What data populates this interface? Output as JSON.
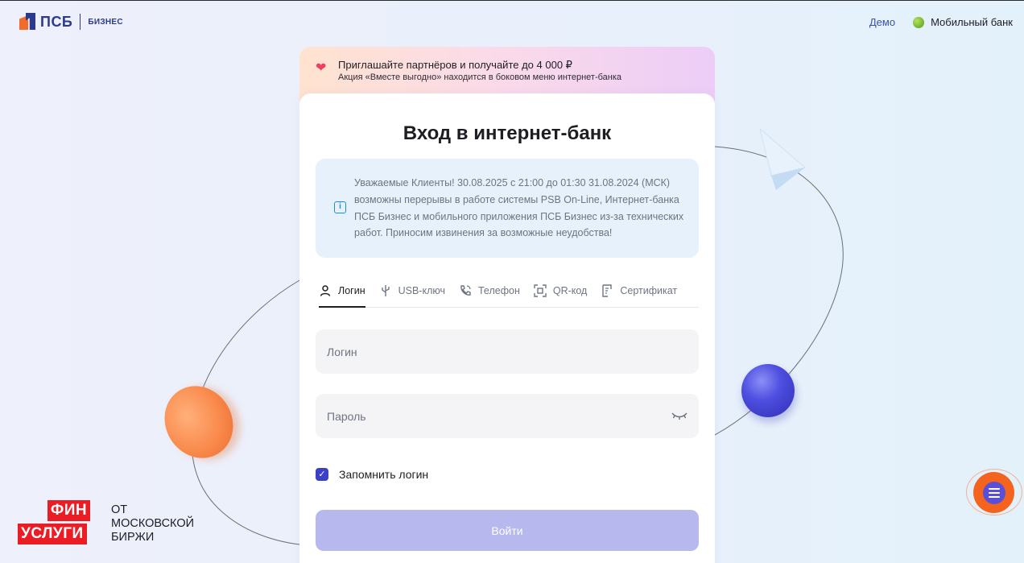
{
  "header": {
    "logo_text": "ПСБ",
    "logo_sub": "БИЗНЕС",
    "demo_label": "Демо",
    "mobile_label": "Мобильный банк"
  },
  "promo": {
    "title": "Приглашайте партнёров и получайте до 4 000 ₽",
    "subtitle": "Акция «Вместе выгодно» находится в боковом меню интернет-банка"
  },
  "card": {
    "title": "Вход в интернет-банк",
    "notice": "Уважаемые Клиенты! 30.08.2025 с 21:00 до 01:30 31.08.2024 (МСК) возможны перерывы в работе системы PSB On-Line, Интернет-банка ПСБ Бизнес и мобильного приложения ПСБ Бизнес из-за технических работ. Приносим извинения за возможные неудобства!",
    "tabs": [
      {
        "label": "Логин",
        "icon": "user-icon",
        "active": true
      },
      {
        "label": "USB-ключ",
        "icon": "usb-icon",
        "active": false
      },
      {
        "label": "Телефон",
        "icon": "phone-icon",
        "active": false
      },
      {
        "label": "QR-код",
        "icon": "qr-icon",
        "active": false
      },
      {
        "label": "Сертификат",
        "icon": "certificate-icon",
        "active": false
      }
    ],
    "login_placeholder": "Логин",
    "login_value": "",
    "password_placeholder": "Пароль",
    "password_value": "",
    "remember_label": "Запомнить логин",
    "remember_checked": true,
    "submit_label": "Войти"
  },
  "badge": {
    "line1": "ФИН",
    "line2": "УСЛУГИ",
    "side1": "ОТ",
    "side2": "МОСКОВСКОЙ",
    "side3": "БИРЖИ"
  },
  "colors": {
    "brand_blue": "#2c3a8c",
    "brand_orange": "#f26b2a",
    "accent_purple": "#3b40c6",
    "button_disabled": "#b6b8ee",
    "notice_bg": "#e6f1fc"
  }
}
